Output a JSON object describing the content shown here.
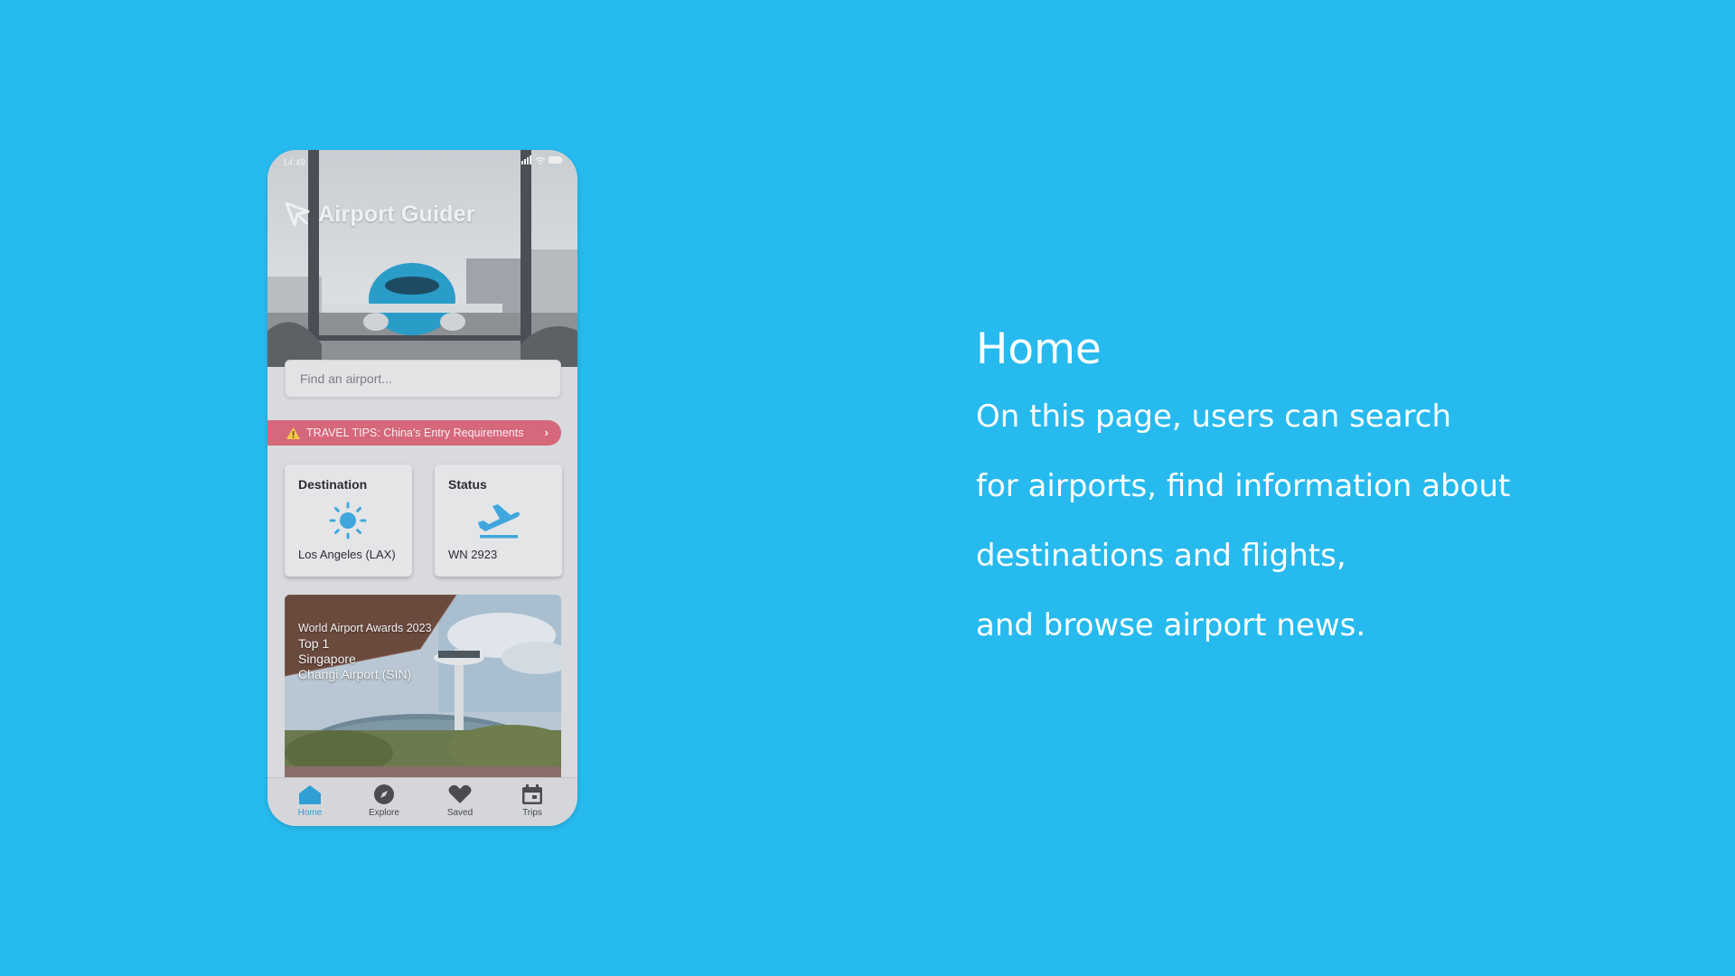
{
  "app": {
    "status_time": "14:49",
    "brand_name": "Airport Guider",
    "search_placeholder": "Find an airport...",
    "tips_text": "TRAVEL TIPS: China's Entry Requirements",
    "cards": {
      "destination_title": "Destination",
      "destination_value": "Los Angeles (LAX)",
      "status_title": "Status",
      "status_value": "WN 2923"
    },
    "news": {
      "line1": "World Airport Awards 2023",
      "line2": "Top 1",
      "line3": "Singapore",
      "line4": "Changi Airport (SIN)"
    },
    "tabs": [
      {
        "label": "Home",
        "icon": "home-icon",
        "active": true
      },
      {
        "label": "Explore",
        "icon": "compass-icon",
        "active": false
      },
      {
        "label": "Saved",
        "icon": "heart-icon",
        "active": false
      },
      {
        "label": "Trips",
        "icon": "calendar-icon",
        "active": false
      }
    ]
  },
  "description": {
    "heading": "Home",
    "lines": [
      "On this page, users can search",
      "for airports, find information about",
      "destinations and flights,",
      "and browse airport news."
    ]
  },
  "colors": {
    "background": "#27BAEE",
    "accent": "#2f9fd4",
    "tips": "#d6687b"
  }
}
